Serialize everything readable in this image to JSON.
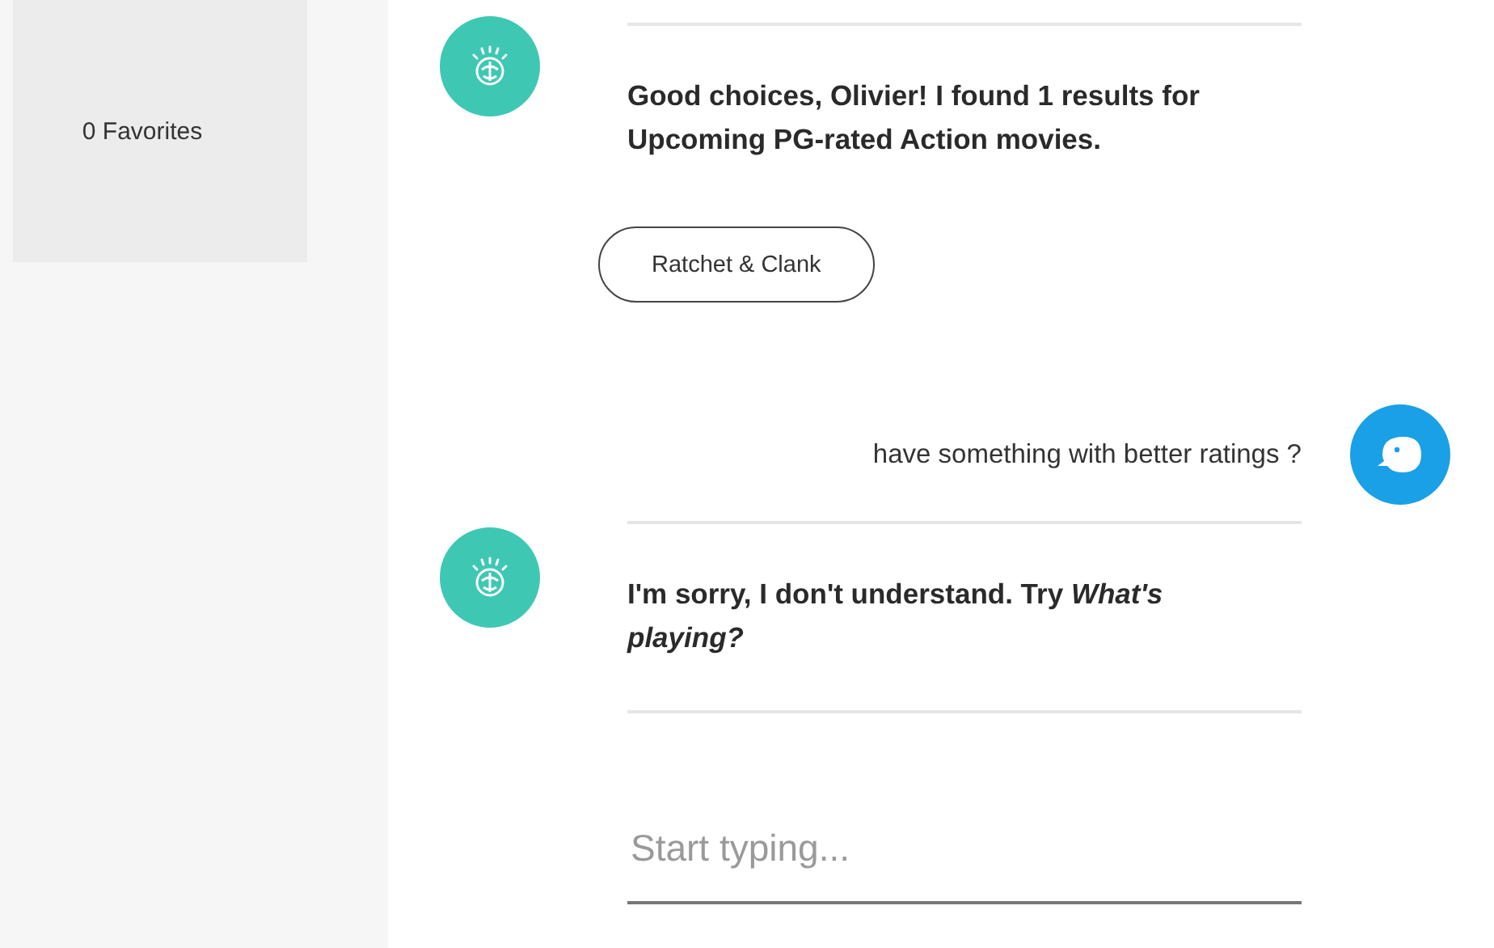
{
  "sidebar": {
    "favorites": "0 Favorites"
  },
  "messages": [
    {
      "kind": "bot",
      "text": "Good choices, Olivier! I found 1 results for Upcoming PG-rated Action movies."
    },
    {
      "kind": "options",
      "options": [
        "Ratchet & Clank"
      ]
    },
    {
      "kind": "user",
      "text": "have something with better ratings ?"
    },
    {
      "kind": "bot",
      "text": "I'm sorry, I don't understand. Try *What's playing?*"
    }
  ],
  "input": {
    "placeholder": "Start typing..."
  }
}
